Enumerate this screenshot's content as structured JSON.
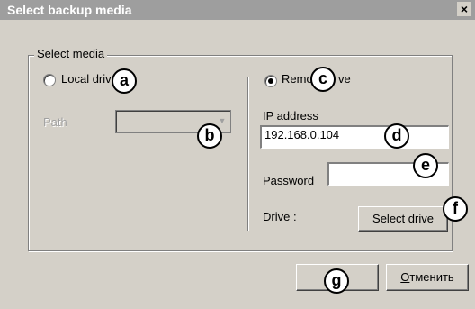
{
  "window": {
    "title": "Select backup media",
    "close_glyph": "×"
  },
  "group": {
    "label": "Select media"
  },
  "local": {
    "label": "Local driv",
    "path_label": "Path",
    "path_value": "",
    "selected": false
  },
  "remote": {
    "label_pre": "Remo",
    "label_post": "ve",
    "selected": true,
    "ip_label": "IP address",
    "ip_value": "192.168.0.104",
    "password_label": "Password",
    "password_value": "",
    "drive_label": "Drive :",
    "select_drive_button": "Select drive"
  },
  "buttons": {
    "ok_label": "",
    "cancel_label_first": "О",
    "cancel_label_rest": "тменить"
  },
  "callouts": [
    "a",
    "b",
    "c",
    "d",
    "e",
    "f",
    "g"
  ]
}
